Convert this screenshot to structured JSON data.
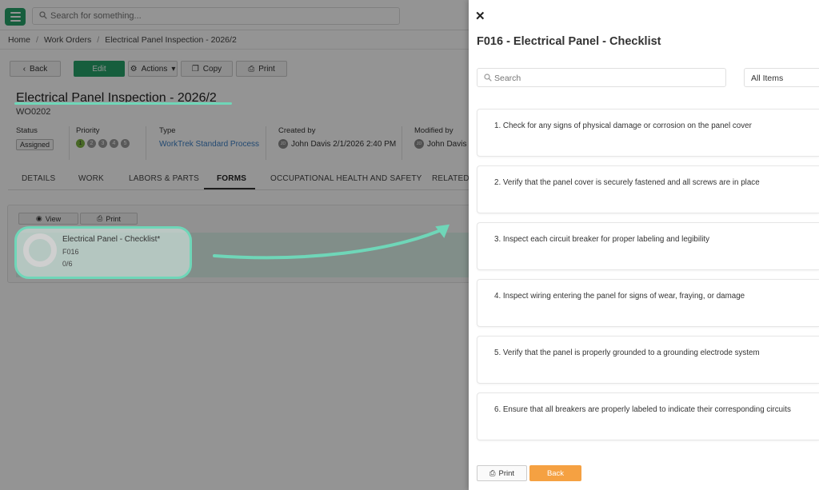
{
  "topbar": {
    "menu_icon": "hamburger-icon",
    "search_placeholder": "Search for something..."
  },
  "breadcrumb": [
    "Home",
    "Work Orders",
    "Electrical Panel Inspection - 2026/2"
  ],
  "toolbar": {
    "back_label": "Back",
    "edit_label": "Edit",
    "actions_label": "Actions",
    "copy_label": "Copy",
    "print_label": "Print"
  },
  "work_order": {
    "title": "Electrical Panel Inspection - 2026/2",
    "code": "WO0202",
    "status_label": "Status",
    "status_value": "Assigned",
    "priority_label": "Priority",
    "priority_levels": [
      "1",
      "2",
      "3",
      "4",
      "5"
    ],
    "priority_selected": 1,
    "type_label": "Type",
    "type_value": "WorkTrek Standard Process",
    "created_label": "Created by",
    "created_avatar": "JD",
    "created_value": "John Davis 2/1/2026 2:40 PM",
    "modified_label": "Modified by",
    "modified_avatar": "JD",
    "modified_value": "John Davis"
  },
  "tabs": [
    "DETAILS",
    "WORK",
    "LABORS & PARTS",
    "FORMS",
    "OCCUPATIONAL HEALTH AND SAFETY",
    "RELATED I"
  ],
  "active_tab": "FORMS",
  "forms": {
    "view_label": "View",
    "print_label": "Print",
    "form_name": "Electrical Panel - Checklist*",
    "form_code": "F016",
    "form_progress": "0/6"
  },
  "drawer": {
    "title": "F016 - Electrical Panel - Checklist",
    "search_placeholder": "Search",
    "filter_value": "All Items",
    "items": [
      "1. Check for any signs of physical damage or corrosion on the panel cover",
      "2. Verify that the panel cover is securely fastened and all screws are in place",
      "3. Inspect each circuit breaker for proper labeling and legibility",
      "4. Inspect wiring entering the panel for signs of wear, fraying, or damage",
      "5. Verify that the panel is properly grounded to a grounding electrode system",
      "6. Ensure that all breakers are properly labeled to indicate their corresponding circuits"
    ],
    "print_label": "Print",
    "back_label": "Back"
  },
  "colors": {
    "brand_green": "#26a269",
    "highlight_teal": "#6fd6b8",
    "back_orange": "#f5a142",
    "link_blue": "#3b7fc4"
  }
}
